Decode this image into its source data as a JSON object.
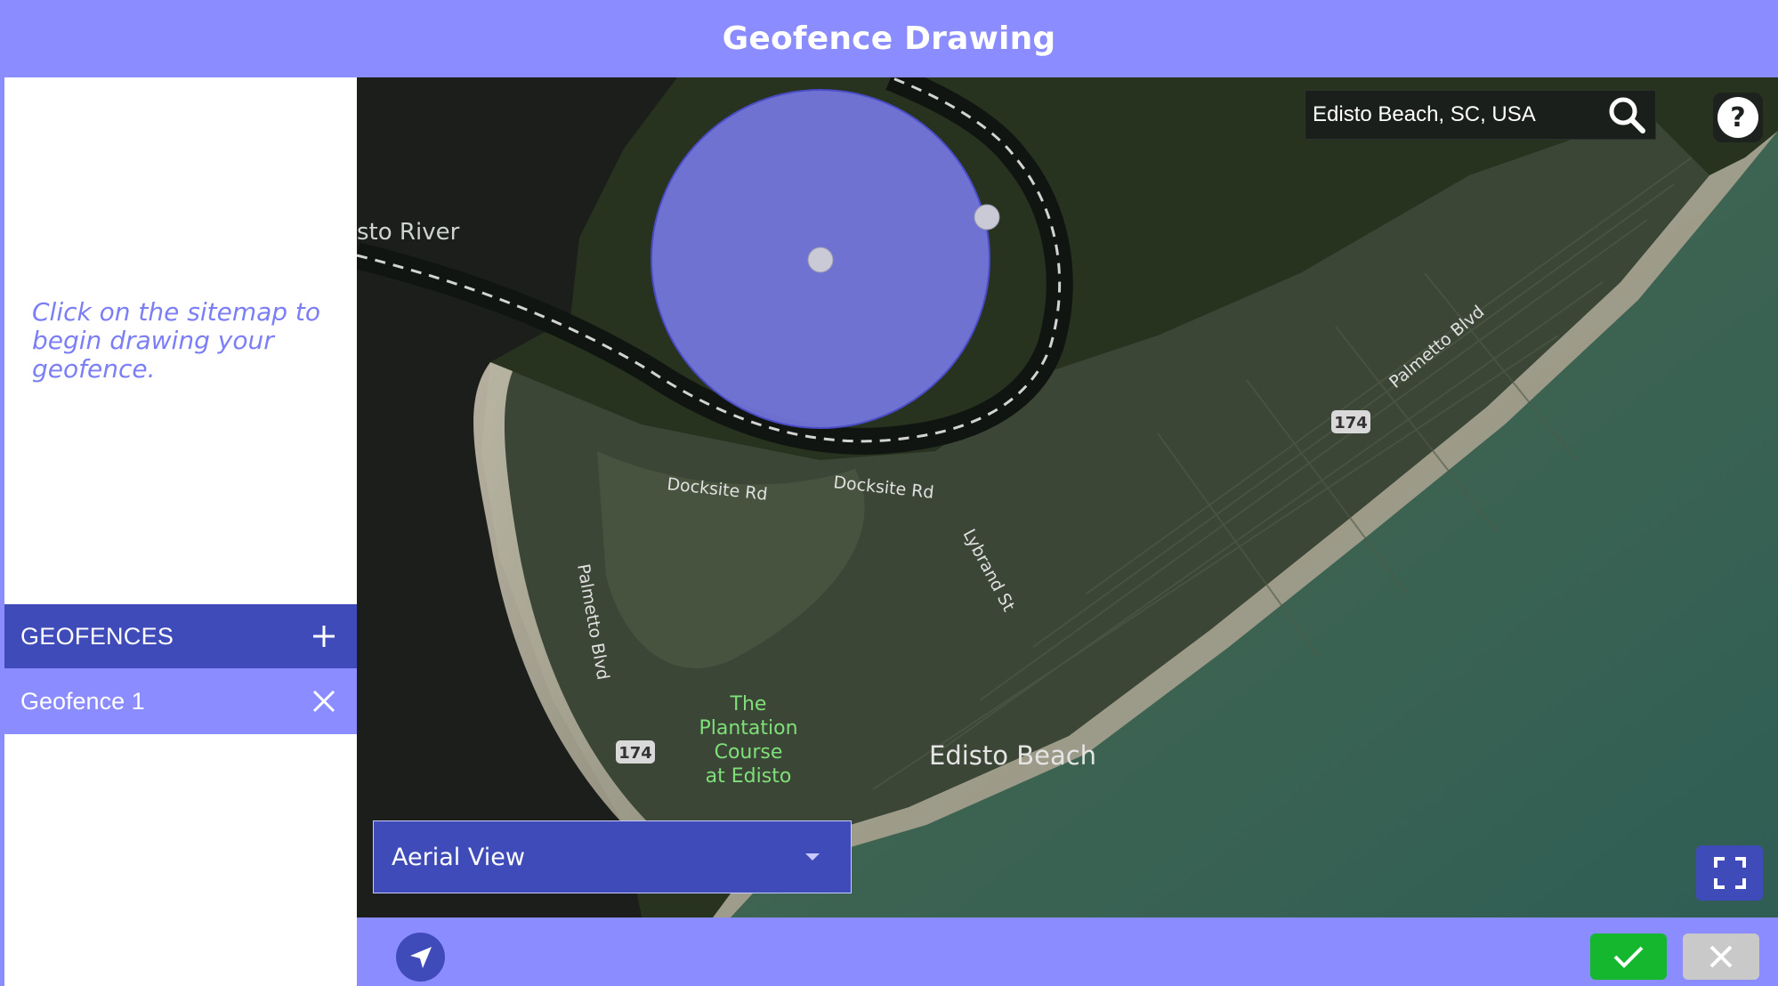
{
  "header": {
    "title": "Geofence Drawing"
  },
  "sidebar": {
    "hint": "Click on the sitemap to begin drawing your geofence.",
    "geofences_label": "GEOFENCES",
    "items": [
      {
        "label": "Geofence 1"
      }
    ]
  },
  "search": {
    "value": "Edisto Beach, SC, USA"
  },
  "map": {
    "view_label": "Aerial View",
    "labels": {
      "river": "sto River",
      "road1": "Docksite Rd",
      "road2": "Docksite Rd",
      "road3": "Lybrand St",
      "road4": "Palmetto Blvd",
      "road5": "Palmetto Blvd",
      "route1": "174",
      "route2": "174",
      "course1": "The",
      "course2": "Plantation",
      "course3": "Course",
      "course4": "at Edisto",
      "town": "Edisto Beach"
    }
  },
  "colors": {
    "accent": "#8a8cff",
    "primary": "#3f4bb8",
    "confirm": "#14b72e",
    "cancel": "#c9c9c9",
    "geofence_fill": "#7577e0"
  },
  "icons": {
    "add": "plus-icon",
    "remove": "close-icon",
    "search": "search-icon",
    "help": "help-icon",
    "dropdown": "chevron-down-icon",
    "fullscreen": "fullscreen-icon",
    "locate": "location-arrow-icon",
    "confirm": "check-icon",
    "cancel": "close-icon"
  }
}
